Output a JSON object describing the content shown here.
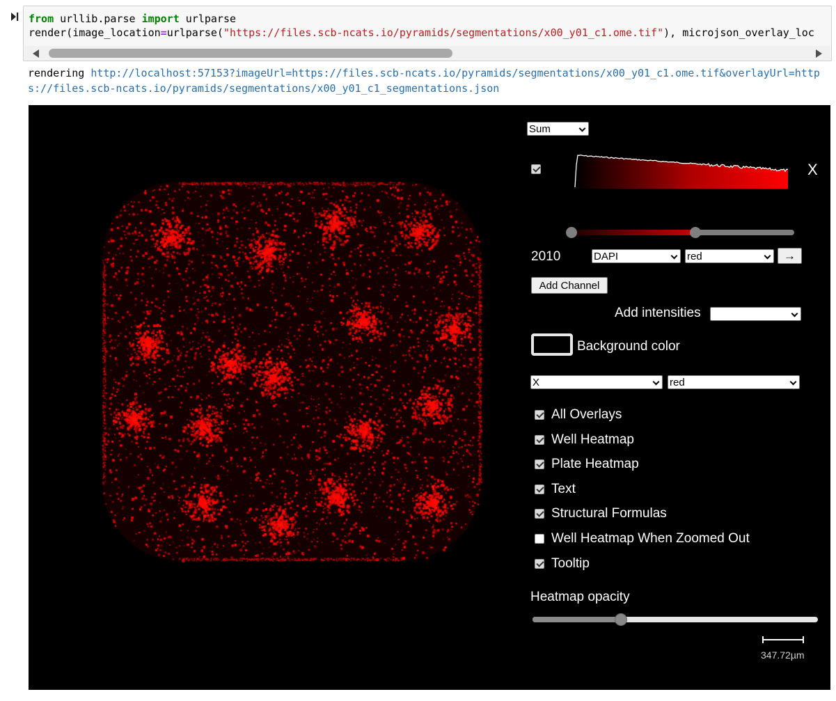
{
  "cell": {
    "run_icon": "run-cell-icon",
    "code": {
      "line1": {
        "kw_from": "from",
        "module": " urllib.parse ",
        "kw_import": "import",
        "name": " urlparse"
      },
      "line2": {
        "prefix": "render(image_location",
        "eq": "=",
        "call": "urlparse(",
        "string": "\"https://files.scb-ncats.io/pyramids/segmentations/x00_y01_c1.ome.tif\"",
        "suffix": "), microjson_overlay_loc"
      }
    }
  },
  "output": {
    "prefix": "rendering ",
    "link": "http://localhost:57153?imageUrl=https://files.scb-ncats.io/pyramids/segmentations/x00_y01_c1.ome.tif&overlayUrl=https://files.scb-ncats.io/pyramids/segmentations/x00_y01_c1_segmentations.json"
  },
  "viewer": {
    "projection_select": "Sum",
    "channel_close": "X",
    "channel_value": "2010",
    "channel_select": "DAPI",
    "color_select": "red",
    "arrow_button": "→",
    "add_channel_button": "Add Channel",
    "add_intensities_label": "Add intensities",
    "add_intensities_select": "",
    "background_color_label": "Background color",
    "overlay_select": "X",
    "overlay_color_select": "red",
    "checkboxes": [
      {
        "label": "All Overlays",
        "checked": true
      },
      {
        "label": "Well Heatmap",
        "checked": true
      },
      {
        "label": "Plate Heatmap",
        "checked": true
      },
      {
        "label": "Text",
        "checked": true
      },
      {
        "label": "Structural Formulas",
        "checked": true
      },
      {
        "label": "Well Heatmap When Zoomed Out",
        "checked": false
      },
      {
        "label": "Tooltip",
        "checked": true
      }
    ],
    "heatmap_opacity_label": "Heatmap opacity",
    "heatmap_opacity": 0.31,
    "contrast_range": [
      0.0,
      0.56
    ],
    "scale_label": "347.72µm",
    "colors": {
      "channel": "#ff0000",
      "background": "#000000"
    }
  }
}
